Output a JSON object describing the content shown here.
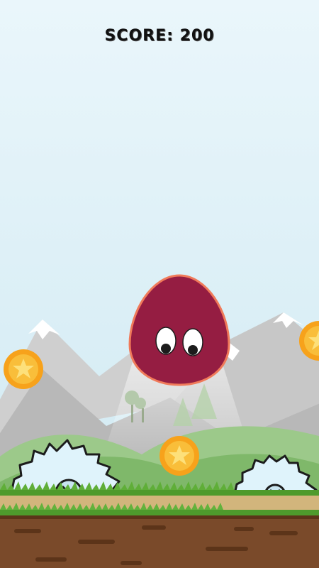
{
  "hud": {
    "score_label": "SCORE:",
    "score_value": "200"
  },
  "colors": {
    "sky_top": "#eaf6fb",
    "sky_bottom": "#cfe9f2",
    "blob_fill": "#951d42",
    "blob_outline": "#f07a5a",
    "coin_outer": "#f7a21b",
    "coin_inner": "#f9be3a",
    "star": "#fde07a",
    "grass": "#4e9a2c",
    "dirt": "#7a4a2a",
    "path": "#d2b57c",
    "saw": "#dff3fb"
  },
  "icons": [
    "star-icon",
    "screw-icon"
  ]
}
